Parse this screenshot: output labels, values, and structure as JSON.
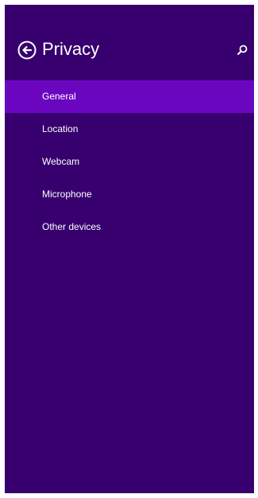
{
  "header": {
    "title": "Privacy",
    "back_icon": "back-arrow-circle-icon",
    "search_icon": "search-icon"
  },
  "nav": {
    "items": [
      {
        "label": "General",
        "selected": true
      },
      {
        "label": "Location",
        "selected": false
      },
      {
        "label": "Webcam",
        "selected": false
      },
      {
        "label": "Microphone",
        "selected": false
      },
      {
        "label": "Other devices",
        "selected": false
      }
    ]
  },
  "colors": {
    "background": "#37006e",
    "selected": "#6a06c0",
    "text": "#ffffff"
  }
}
